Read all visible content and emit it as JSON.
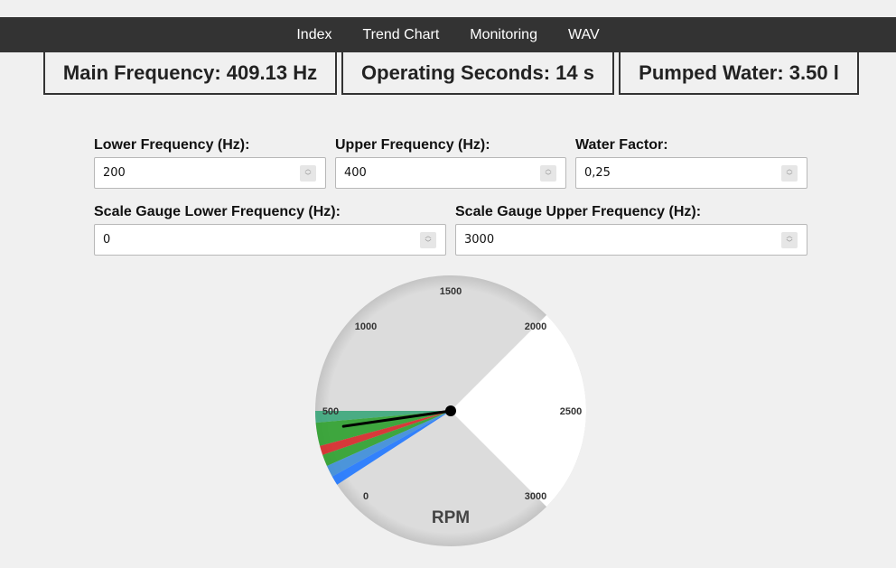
{
  "nav": {
    "items": [
      "Index",
      "Trend Chart",
      "Monitoring",
      "WAV"
    ]
  },
  "stats": {
    "main_frequency": "Main Frequency: 409.13 Hz",
    "operating_seconds": "Operating Seconds: 14 s",
    "pumped_water": "Pumped Water: 3.50 l"
  },
  "form": {
    "lower_frequency": {
      "label": "Lower Frequency (Hz):",
      "value": "200"
    },
    "upper_frequency": {
      "label": "Upper Frequency (Hz):",
      "value": "400"
    },
    "water_factor": {
      "label": "Water Factor:",
      "value": "0,25"
    },
    "scale_lower": {
      "label": "Scale Gauge Lower Frequency (Hz):",
      "value": "0"
    },
    "scale_upper": {
      "label": "Scale Gauge Upper Frequency (Hz):",
      "value": "3000"
    }
  },
  "gauge": {
    "unit_label": "RPM",
    "min": 0,
    "max": 3000,
    "value": 409.13,
    "ticks": [
      "0",
      "500",
      "1000",
      "1500",
      "2000",
      "2500",
      "3000"
    ],
    "colors": {
      "face": "#dcdcdc",
      "rim": "#cfcfcf",
      "green": "#2ca02c",
      "red": "#d62728",
      "blue": "#1f77ff",
      "needle": "#000000"
    }
  }
}
